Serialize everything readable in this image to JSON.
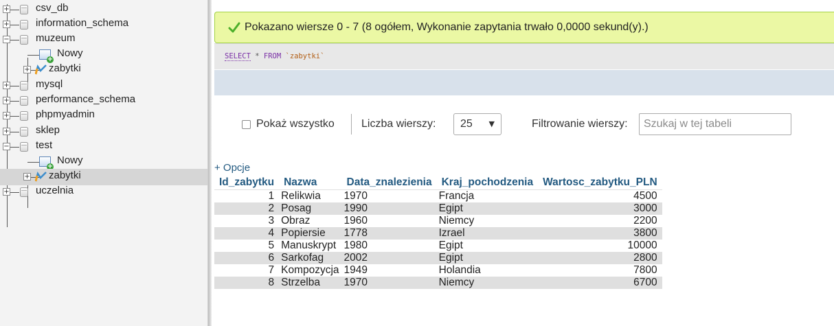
{
  "navigation": {
    "databases": [
      {
        "name": "csv_db",
        "expanded": false
      },
      {
        "name": "information_schema",
        "expanded": false
      },
      {
        "name": "muzeum",
        "expanded": true,
        "children": [
          {
            "type": "new",
            "label": "Nowy"
          },
          {
            "type": "table",
            "label": "zabytki"
          }
        ]
      },
      {
        "name": "mysql",
        "expanded": false
      },
      {
        "name": "performance_schema",
        "expanded": false
      },
      {
        "name": "phpmyadmin",
        "expanded": false
      },
      {
        "name": "sklep",
        "expanded": false
      },
      {
        "name": "test",
        "expanded": true,
        "children": [
          {
            "type": "new",
            "label": "Nowy"
          },
          {
            "type": "table",
            "label": "zabytki",
            "selected": true
          }
        ]
      },
      {
        "name": "uczelnia",
        "expanded": false
      }
    ]
  },
  "message": {
    "text": "Pokazano wiersze 0 - 7 (8 ogółem, Wykonanie zapytania trwało 0,0000 sekund(y).)"
  },
  "sql": {
    "select": "SELECT",
    "star": " * ",
    "from": "FROM",
    "table": " `zabytki`"
  },
  "controls": {
    "show_all_label": "Pokaż wszystko",
    "show_all_checked": false,
    "rows_label": "Liczba wierszy:",
    "rows_value": "25",
    "filter_label": "Filtrowanie wierszy:",
    "filter_placeholder": "Szukaj w tej tabeli"
  },
  "options_link": "+ Opcje",
  "table": {
    "columns": [
      "Id_zabytku",
      "Nazwa",
      "Data_znalezienia",
      "Kraj_pochodzenia",
      "Wartosc_zabytku_PLN"
    ],
    "rows": [
      [
        "1",
        "Relikwia",
        "1970",
        "Francja",
        "4500"
      ],
      [
        "2",
        "Posag",
        "1990",
        "Egipt",
        "3000"
      ],
      [
        "3",
        "Obraz",
        "1960",
        "Niemcy",
        "2200"
      ],
      [
        "4",
        "Popiersie",
        "1778",
        "Izrael",
        "3800"
      ],
      [
        "5",
        "Manuskrypt",
        "1980",
        "Egipt",
        "10000"
      ],
      [
        "6",
        "Sarkofag",
        "2002",
        "Egipt",
        "2800"
      ],
      [
        "7",
        "Kompozycja",
        "1949",
        "Holandia",
        "7800"
      ],
      [
        "8",
        "Strzelba",
        "1970",
        "Niemcy",
        "6700"
      ]
    ]
  },
  "colors": {
    "success_bg": "#ebf8a4",
    "success_border": "#a2d246",
    "header_link": "#235a81",
    "row_even": "#dfdfdf"
  }
}
